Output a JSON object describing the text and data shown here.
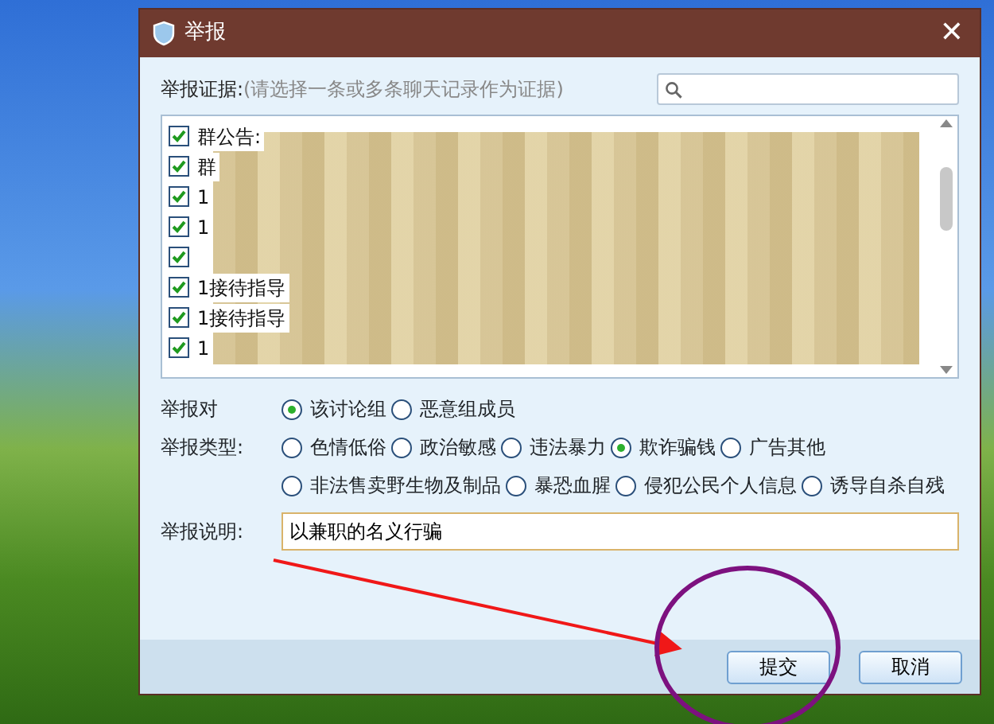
{
  "window": {
    "title": "举报",
    "close": "✕"
  },
  "evidence": {
    "label": "举报证据:",
    "hint": "(请选择一条或多条聊天记录作为证据)",
    "rows": [
      {
        "text": "群公告:",
        "checked": true
      },
      {
        "text": "群",
        "checked": true
      },
      {
        "text": "1",
        "checked": true
      },
      {
        "text": "1",
        "checked": true
      },
      {
        "checked": true
      },
      {
        "text": "1接待指导",
        "checked": true
      },
      {
        "text": "1接待指导",
        "checked": true
      },
      {
        "text": "1",
        "checked": true
      }
    ]
  },
  "target": {
    "label": "举报对",
    "options": [
      {
        "label": "该讨论组",
        "selected": true
      },
      {
        "label": "恶意组成员",
        "selected": false
      }
    ]
  },
  "report_type": {
    "label": "举报类型:",
    "options": [
      {
        "label": "色情低俗",
        "selected": false
      },
      {
        "label": "政治敏感",
        "selected": false
      },
      {
        "label": "违法暴力",
        "selected": false
      },
      {
        "label": "欺诈骗钱",
        "selected": true
      },
      {
        "label": "广告其他",
        "selected": false
      },
      {
        "label": "非法售卖野生物及制品",
        "selected": false
      },
      {
        "label": "暴恐血腥",
        "selected": false
      },
      {
        "label": "侵犯公民个人信息",
        "selected": false
      },
      {
        "label": "诱导自杀自残",
        "selected": false
      }
    ]
  },
  "description": {
    "label": "举报说明:",
    "value": "以兼职的名义行骗"
  },
  "buttons": [
    "提交",
    "取消"
  ]
}
